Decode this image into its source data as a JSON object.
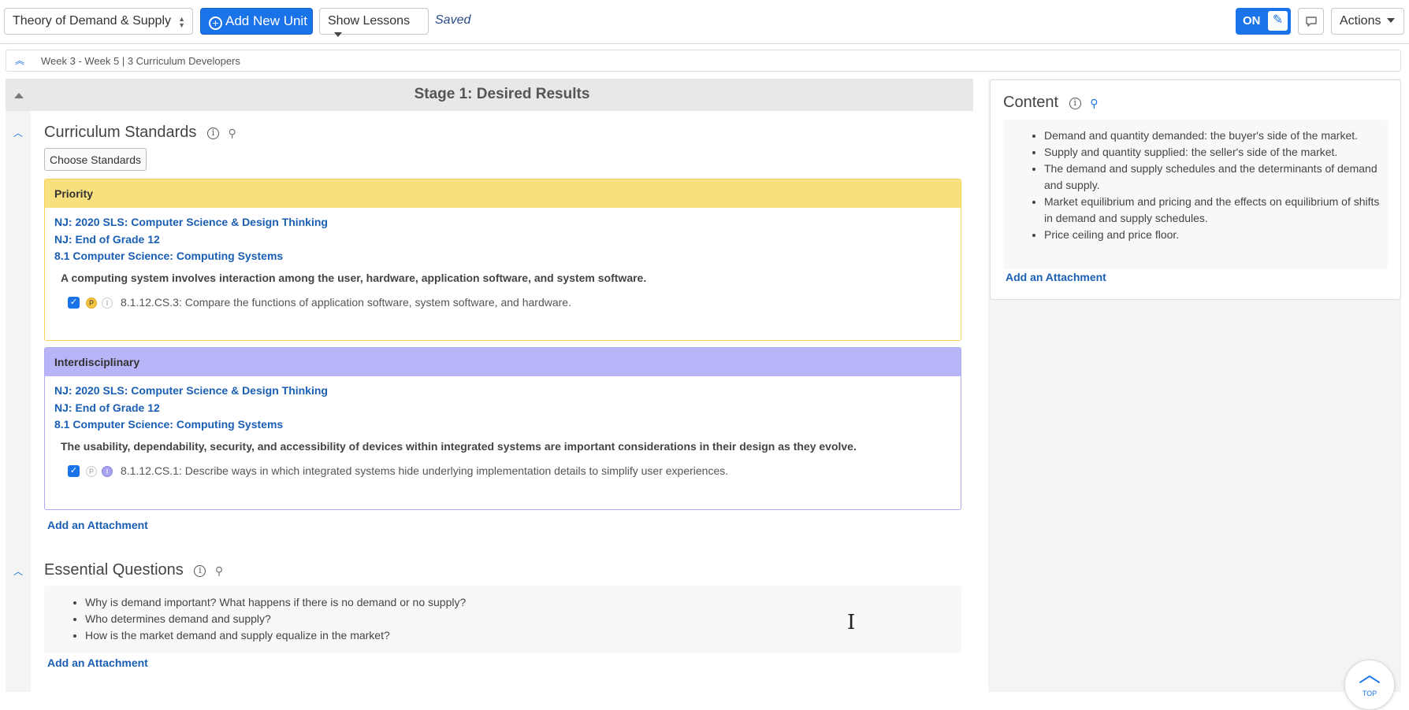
{
  "toolbar": {
    "unit_select": "Theory of Demand & Supply",
    "add_unit_label": "Add New Unit",
    "show_lessons_label": "Show Lessons",
    "saved_label": "Saved",
    "toggle_label": "ON",
    "actions_label": "Actions"
  },
  "infobar": {
    "text": "Week 3 - Week 5 |  3 Curriculum Developers"
  },
  "stage": {
    "title": "Stage 1: Desired Results"
  },
  "standards": {
    "title": "Curriculum Standards",
    "choose_label": "Choose Standards",
    "priority": {
      "header": "Priority",
      "links": [
        "NJ: 2020 SLS: Computer Science & Design Thinking",
        "NJ: End of Grade 12",
        "8.1 Computer Science: Computing Systems"
      ],
      "description": "A computing system involves interaction among the user, hardware, application software, and system software.",
      "item": "8.1.12.CS.3: Compare the functions of application software, system software, and hardware."
    },
    "interdisciplinary": {
      "header": "Interdisciplinary",
      "links": [
        "NJ: 2020 SLS: Computer Science & Design Thinking",
        "NJ: End of Grade 12",
        "8.1 Computer Science: Computing Systems"
      ],
      "description": "The usability, dependability, security, and accessibility of devices within integrated systems are important considerations in their design as they evolve.",
      "item": "8.1.12.CS.1: Describe ways in which integrated systems hide underlying implementation details to simplify user experiences."
    },
    "badge_p": "P",
    "badge_i": "I",
    "attach_label": "Add an Attachment"
  },
  "essential": {
    "title": "Essential Questions",
    "questions": [
      "Why is demand important? What happens if there is no demand or no supply?",
      "Who determines demand and supply?",
      "How is the market demand and supply equalize in the market?"
    ],
    "attach_label": "Add an Attachment"
  },
  "content": {
    "title": "Content",
    "items": [
      "Demand and quantity demanded: the buyer's side of the market.",
      "Supply and quantity supplied: the seller's side of the market.",
      "The demand and supply schedules and the determinants of demand and supply.",
      "Market equilibrium and pricing and the effects on equilibrium of shifts in demand and supply schedules.",
      "Price ceiling and price floor."
    ],
    "attach_label": "Add an Attachment"
  },
  "top_button": {
    "label": "TOP"
  },
  "colors": {
    "accent": "#1a73e8",
    "priority": "#f8e07e",
    "interdisciplinary": "#b8b4f8"
  }
}
